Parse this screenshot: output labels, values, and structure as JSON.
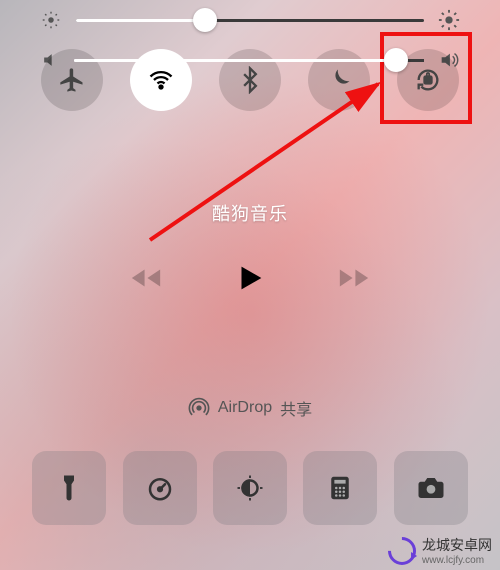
{
  "toggles": [
    {
      "name": "airplane",
      "on": false
    },
    {
      "name": "wifi",
      "on": true
    },
    {
      "name": "bluetooth",
      "on": false
    },
    {
      "name": "dnd",
      "on": false
    },
    {
      "name": "rotation-lock",
      "on": false
    }
  ],
  "brightness": {
    "value": 37
  },
  "music": {
    "title": "酷狗音乐"
  },
  "volume": {
    "value": 92
  },
  "airdrop": {
    "prefix": "AirDrop",
    "label": "共享"
  },
  "shortcuts": [
    {
      "name": "flashlight"
    },
    {
      "name": "timer"
    },
    {
      "name": "night-shift"
    },
    {
      "name": "calculator"
    },
    {
      "name": "camera"
    }
  ],
  "watermark": {
    "site": "龙城安卓网",
    "url": "www.lcjfy.com"
  }
}
